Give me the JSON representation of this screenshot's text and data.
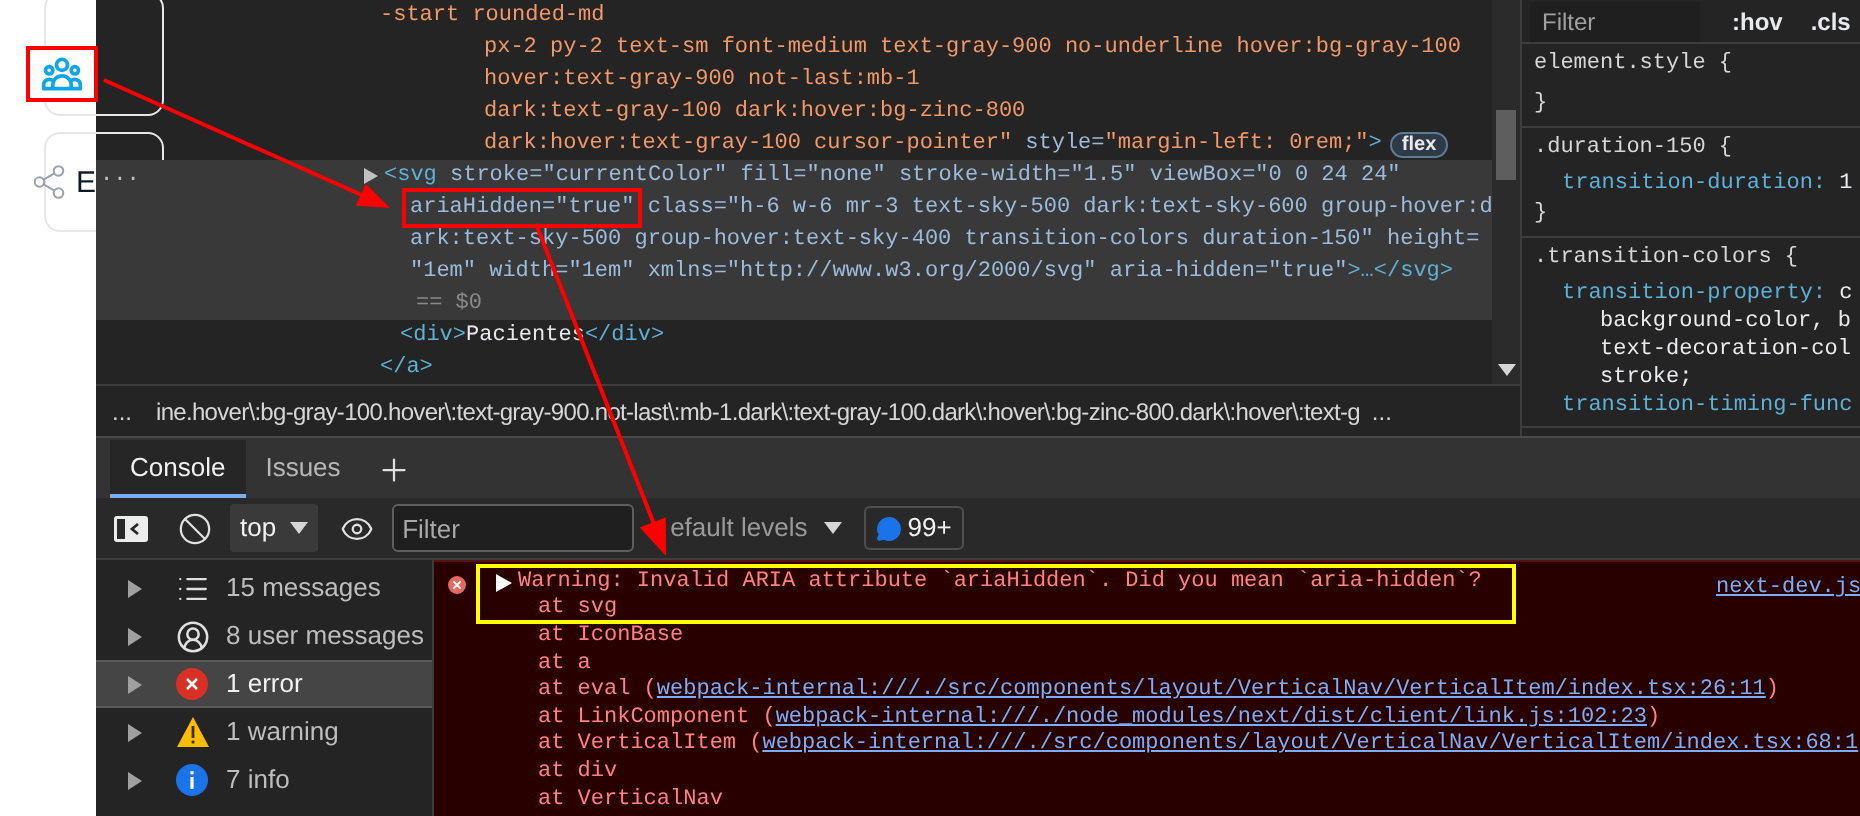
{
  "page": {
    "nav_icon_highlighted": true,
    "partial_label": "E"
  },
  "elements": {
    "lines": [
      {
        "kind": "wrap",
        "selected": false,
        "segments": [
          {
            "kind": "value",
            "text": "-start rounded-md"
          }
        ]
      },
      {
        "kind": "attr-wrap",
        "selected": false,
        "segments": [
          {
            "kind": "value",
            "text": "px-2 py-2 text-sm font-medium text-gray-900 no-underline hover:bg-gray-100"
          }
        ]
      },
      {
        "kind": "attr-wrap",
        "selected": false,
        "segments": [
          {
            "kind": "value",
            "text": "hover:text-gray-900 not-last:mb-1"
          }
        ]
      },
      {
        "kind": "attr-wrap",
        "selected": false,
        "segments": [
          {
            "kind": "value",
            "text": "dark:text-gray-100 dark:hover:bg-zinc-800"
          }
        ]
      },
      {
        "kind": "attr-wrap",
        "selected": false,
        "badge": "flex",
        "segments": [
          {
            "kind": "value",
            "text": "dark:hover:text-gray-100 cursor-pointer\""
          },
          {
            "kind": "attr",
            "text": " style="
          },
          {
            "kind": "value",
            "text": "\"margin-left: 0rem;\""
          },
          {
            "kind": "tag",
            "text": ">"
          }
        ]
      },
      {
        "kind": "node",
        "selected": true,
        "expanded": false,
        "dots": "...",
        "segments": [
          {
            "kind": "tag",
            "text": "<svg"
          },
          {
            "kind": "attr",
            "text": " stroke=\"currentColor\" fill=\"none\" stroke-width=\"1.5\" viewBox=\"0 0 24 24\""
          }
        ]
      },
      {
        "kind": "node-wrap",
        "selected": true,
        "segments": [
          {
            "kind": "attr",
            "text": "ariaHidden=\"true\"",
            "highlighted": true
          },
          {
            "kind": "attr",
            "text": " class=\"h-6 w-6 mr-3 text-sky-500 dark:text-sky-600 group-hover:d"
          }
        ]
      },
      {
        "kind": "node-wrap",
        "selected": true,
        "segments": [
          {
            "kind": "attr",
            "text": "ark:text-sky-500 group-hover:text-sky-400 transition-colors duration-150\" height="
          }
        ]
      },
      {
        "kind": "node-wrap",
        "selected": true,
        "segments": [
          {
            "kind": "attr",
            "text": "\"1em\" width=\"1em\" xmlns=\"http://www.w3.org/2000/svg\" aria-hidden=\"true\""
          },
          {
            "kind": "tag",
            "text": ">…</svg>"
          }
        ]
      },
      {
        "kind": "marker",
        "selected": true,
        "segments": [
          {
            "kind": "dim",
            "text": "== $0"
          }
        ]
      },
      {
        "kind": "child",
        "selected": false,
        "segments": [
          {
            "kind": "tag",
            "text": "<div>"
          },
          {
            "kind": "text",
            "text": "Pacientes"
          },
          {
            "kind": "tag",
            "text": "</div>"
          }
        ]
      },
      {
        "kind": "close",
        "selected": false,
        "segments": [
          {
            "kind": "tag",
            "text": "</a>"
          }
        ]
      }
    ],
    "breadcrumb": {
      "lead": "...",
      "path": "ine.hover\\:bg-gray-100.hover\\:text-gray-900.not-last\\:mb-1.dark\\:text-gray-100.dark\\:hover\\:bg-zinc-800.dark\\:hover\\:text-g",
      "trail": "..."
    }
  },
  "styles": {
    "filter": {
      "placeholder": "Filter"
    },
    "toggles": [
      ":hov",
      ".cls"
    ],
    "rules": [
      {
        "open": "element.style {",
        "close": "}"
      },
      {
        "open": ".duration-150 {",
        "declarations": [
          {
            "kind": "decl",
            "property": "transition-duration:",
            "value": "1"
          }
        ],
        "close": "}"
      },
      {
        "open": ".transition-colors {",
        "declarations": [
          {
            "kind": "decl",
            "property": "transition-property:",
            "value": "c"
          },
          {
            "kind": "wrap",
            "value": "background-color, b"
          },
          {
            "kind": "wrap",
            "value": "text-decoration-col"
          },
          {
            "kind": "wrap",
            "value": "stroke;"
          },
          {
            "kind": "decl",
            "property": "transition-timing-func"
          }
        ]
      }
    ]
  },
  "drawer": {
    "tabs": [
      {
        "label": "Console",
        "selected": true
      },
      {
        "label": "Issues",
        "selected": false
      }
    ],
    "toolbar": {
      "context": "top",
      "filter": {
        "placeholder": "Filter"
      },
      "levels": "efault levels",
      "badge": "99+"
    },
    "sidebar": [
      {
        "kind": "all",
        "label": "15 messages",
        "selected": false
      },
      {
        "kind": "user",
        "label": "8 user messages",
        "selected": false
      },
      {
        "kind": "error",
        "label": "1 error",
        "selected": true
      },
      {
        "kind": "warning",
        "label": "1 warning",
        "selected": false
      },
      {
        "kind": "info",
        "label": "7 info",
        "selected": false
      }
    ],
    "message": {
      "highlighted": true,
      "expanded": false,
      "text": "Warning: Invalid ARIA attribute `ariaHidden`. Did you mean `aria-hidden`?",
      "source": "next-dev.js",
      "stack": [
        {
          "text": "at svg"
        },
        {
          "text": "at IconBase"
        },
        {
          "text": "at a"
        },
        {
          "text": "at eval (",
          "link": "webpack-internal:///./src/components/layout/VerticalNav/VerticalItem/index.tsx:26:11",
          "close": ")"
        },
        {
          "text": "at LinkComponent (",
          "link": "webpack-internal:///./node_modules/next/dist/client/link.js:102:23",
          "close": ")"
        },
        {
          "text": "at VerticalItem (",
          "link": "webpack-internal:///./src/components/layout/VerticalNav/VerticalItem/index.tsx:68:1"
        },
        {
          "text": "at div"
        },
        {
          "text": "at VerticalNav"
        }
      ]
    }
  }
}
